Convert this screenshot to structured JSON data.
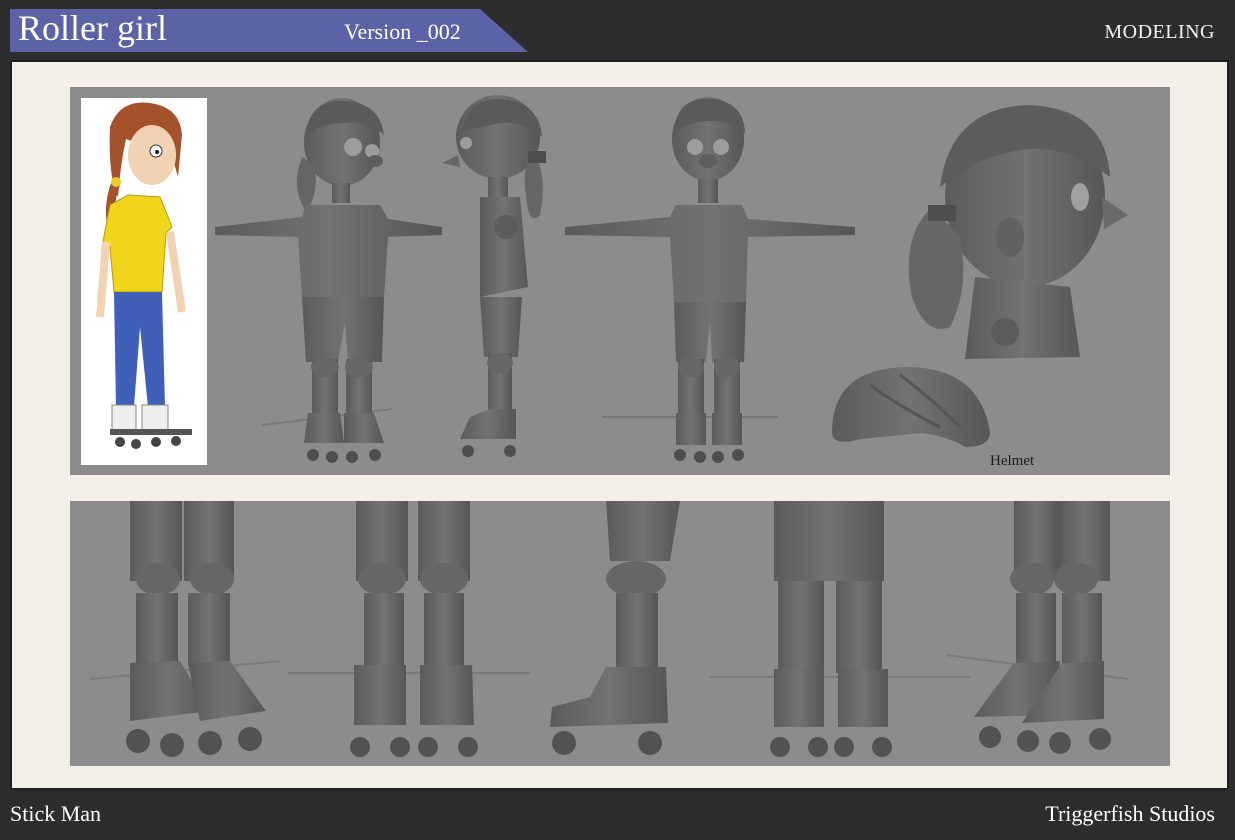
{
  "header": {
    "title": "Roller girl",
    "version": "Version _002",
    "section": "MODELING",
    "banner_color": "#5b62a6"
  },
  "sheet": {
    "top_panel": {
      "figures": [
        "concept-art",
        "front-view",
        "side-view",
        "back-view",
        "head-closeup",
        "helmet"
      ],
      "helmet_label": "Helmet"
    },
    "bottom_panel": {
      "figures": [
        "legs-3q-front",
        "legs-front",
        "legs-side",
        "legs-back",
        "legs-3q-back"
      ]
    }
  },
  "footer": {
    "left": "Stick Man",
    "right": "Triggerfish Studios"
  }
}
